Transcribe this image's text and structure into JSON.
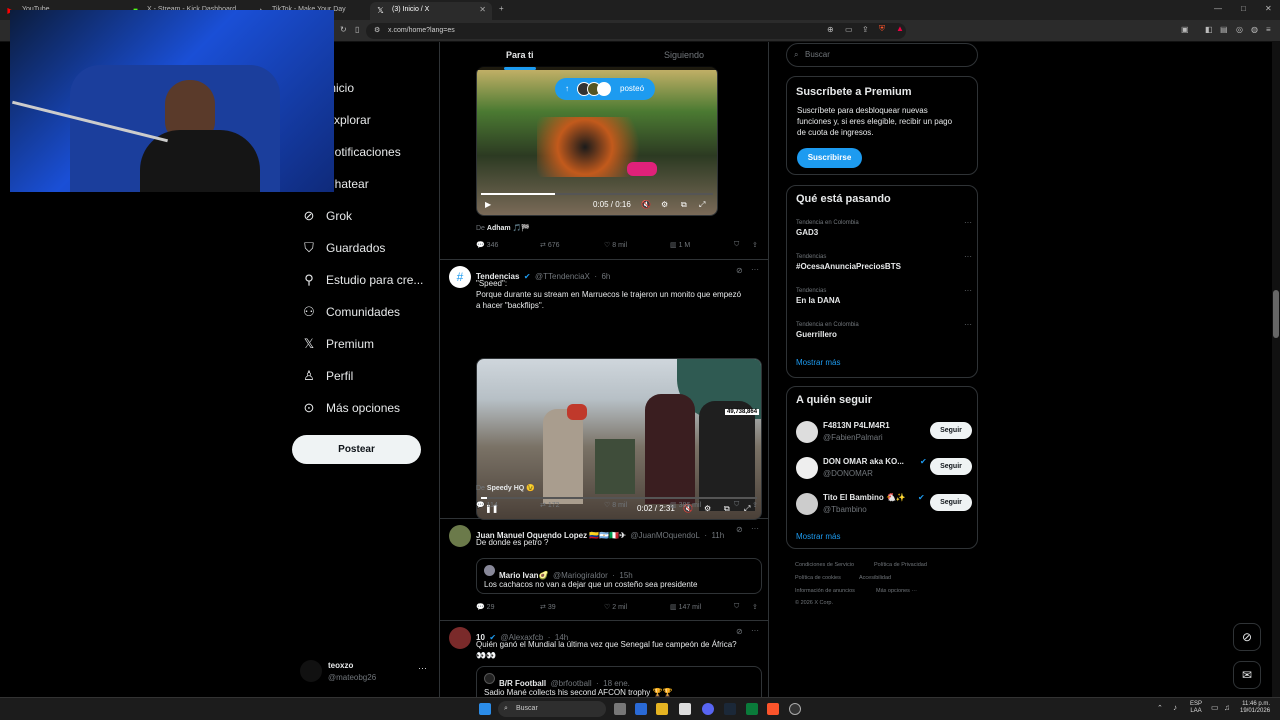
{
  "browser": {
    "tabs": [
      {
        "label": "YouTube"
      },
      {
        "label": "X - Stream - Kick Dashboard"
      },
      {
        "label": "TikTok - Make Your Day"
      }
    ],
    "active_tab": {
      "label": "(3) Inicio / X"
    },
    "url": "x.com/home?lang=es"
  },
  "nav": {
    "items": [
      {
        "label": "Inicio",
        "icon": "home-icon"
      },
      {
        "label": "Explorar",
        "icon": "search-icon"
      },
      {
        "label": "Notificaciones",
        "icon": "bell-icon"
      },
      {
        "label": "Chatear",
        "icon": "chat-icon"
      },
      {
        "label": "Grok",
        "icon": "grok-icon"
      },
      {
        "label": "Guardados",
        "icon": "bookmark-icon"
      },
      {
        "label": "Estudio para cre...",
        "icon": "studio-icon"
      },
      {
        "label": "Comunidades",
        "icon": "communities-icon"
      },
      {
        "label": "Premium",
        "icon": "x-logo-icon"
      },
      {
        "label": "Perfil",
        "icon": "person-icon"
      },
      {
        "label": "Más opciones",
        "icon": "more-icon"
      }
    ],
    "post_button": "Postear",
    "account": {
      "name": "teoxzo",
      "handle": "@mateobg26"
    }
  },
  "feed": {
    "tabs": {
      "for_you": "Para ti",
      "following": "Siguiendo"
    },
    "new_posts_pill": "posteó",
    "tweet1": {
      "video_time": "0:05 / 0:16",
      "source": "De",
      "source_name": "Adham 🎵🏁",
      "replies": "346",
      "retweets": "676",
      "likes": "8 mil",
      "views": "1 M"
    },
    "tweet2": {
      "name": "Tendencias",
      "handle": "@TTendenciaX",
      "time": "6h",
      "text_line1": "\"Speed\":",
      "text_line2": "Porque durante su stream en Marruecos le trajeron un monito que empezó",
      "text_line3": "a hacer \"backflips\".",
      "video_viewers": "49,738,864",
      "video_time": "0:02 / 2:31",
      "source": "De",
      "source_name": "Speedy HQ 😉",
      "replies": "114",
      "retweets": "172",
      "likes": "8 mil",
      "views": "386 mil"
    },
    "tweet3": {
      "name": "Juan Manuel Oquendo Lopez 🇨🇴🇦🇷🇮🇹✈",
      "handle": "@JuanMOquendoL",
      "time": "11h",
      "text": "De donde es petro ?",
      "quote_name": "Mario Ivan🥑",
      "quote_handle": "@Mariogiraldor",
      "quote_time": "15h",
      "quote_text": "Los cachacos no van a dejar que un costeño sea presidente",
      "replies": "29",
      "retweets": "39",
      "likes": "2 mil",
      "views": "147 mil"
    },
    "tweet4": {
      "name": "10",
      "handle": "@Alexaxfcb",
      "time": "14h",
      "text": "Quién ganó el Mundial la última vez que Senegal fue campeón de África?",
      "emoji_line": "👀👀",
      "quote_name": "B/R Football",
      "quote_handle": "@brfootball",
      "quote_time": "18 ene.",
      "quote_text": "Sadio Mané collects his second AFCON trophy 🏆🏆"
    }
  },
  "sidebar": {
    "search_placeholder": "Buscar",
    "premium": {
      "title": "Suscríbete a Premium",
      "text_line1": "Suscríbete para desbloquear nuevas",
      "text_line2": "funciones y, si eres elegible, recibir un pago",
      "text_line3": "de cuota de ingresos.",
      "button": "Suscribirse"
    },
    "trends": {
      "title": "Qué está pasando",
      "items": [
        {
          "context": "Tendencia en Colombia",
          "name": "GAD3"
        },
        {
          "context": "Tendencias",
          "name": "#OcesaAnunciaPreciosBTS"
        },
        {
          "context": "Tendencias",
          "name": "En la DANA"
        },
        {
          "context": "Tendencia en Colombia",
          "name": "Guerrillero"
        }
      ],
      "show_more": "Mostrar más"
    },
    "who_to_follow": {
      "title": "A quién seguir",
      "items": [
        {
          "name": "F4813N P4LM4R1",
          "handle": "@FabienPalmari",
          "button": "Seguir"
        },
        {
          "name": "DON OMAR aka KO...",
          "handle": "@DONOMAR",
          "button": "Seguir"
        },
        {
          "name": "Tito El Bambino 🐔✨",
          "handle": "@Tbambino",
          "button": "Seguir"
        }
      ],
      "show_more": "Mostrar más"
    },
    "footer": {
      "l1": "Condiciones de Servicio",
      "l2": "Política de Privacidad",
      "l3": "Política de cookies",
      "l4": "Accesibilidad",
      "l5": "Información de anuncios",
      "l6": "Más opciones ···",
      "l7": "© 2026 X Corp."
    }
  },
  "taskbar": {
    "search": "Buscar",
    "lang": "ESP",
    "lang2": "LAA",
    "time": "11:46 p.m.",
    "date": "19/01/2026"
  },
  "colors": {
    "accent": "#1d9bf0",
    "bg": "#000000",
    "border": "#2f3336",
    "muted": "#71767b"
  }
}
